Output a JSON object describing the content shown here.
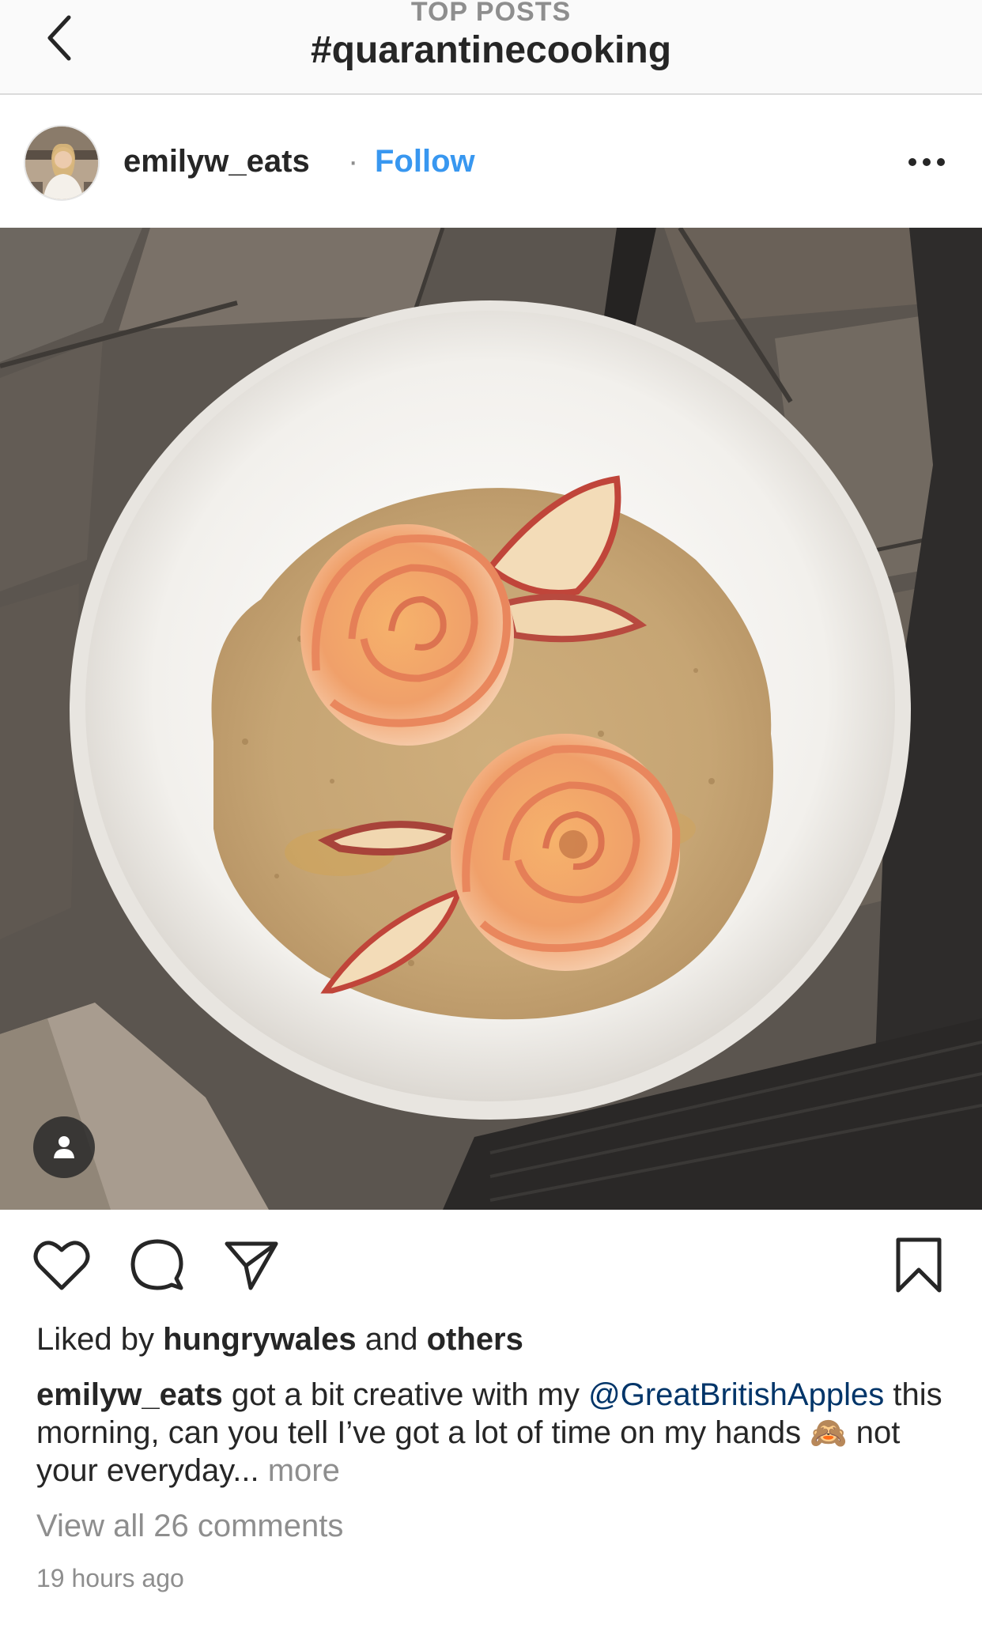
{
  "header": {
    "subtitle": "TOP POSTS",
    "title": "#quarantinecooking"
  },
  "post": {
    "username": "emilyw_eats",
    "separator": "·",
    "follow_label": "Follow",
    "liked_by_prefix": "Liked by",
    "liked_by_user": "hungrywales",
    "liked_by_and": "and",
    "liked_by_others": "others",
    "caption": {
      "username": "emilyw_eats",
      "text_before_mention": "got a bit creative with my",
      "mention": "@GreatBritishApples",
      "text_after_mention": "this morning, can you tell I’ve got a lot of time on my hands",
      "emoji": "🙈",
      "text_after_emoji": "not your everyday...",
      "more_label": "more"
    },
    "view_comments": "View all 26 comments",
    "timestamp": "19 hours ago"
  },
  "icons": {
    "back": "chevron-left-icon",
    "more": "ellipsis-icon",
    "user_tag": "person-icon",
    "like": "heart-icon",
    "comment": "comment-bubble-icon",
    "share": "paper-plane-icon",
    "save": "bookmark-icon"
  },
  "colors": {
    "link_blue": "#3897f0",
    "mention_blue": "#003569",
    "secondary_text": "#8e8e8e",
    "primary_text": "#262626"
  }
}
